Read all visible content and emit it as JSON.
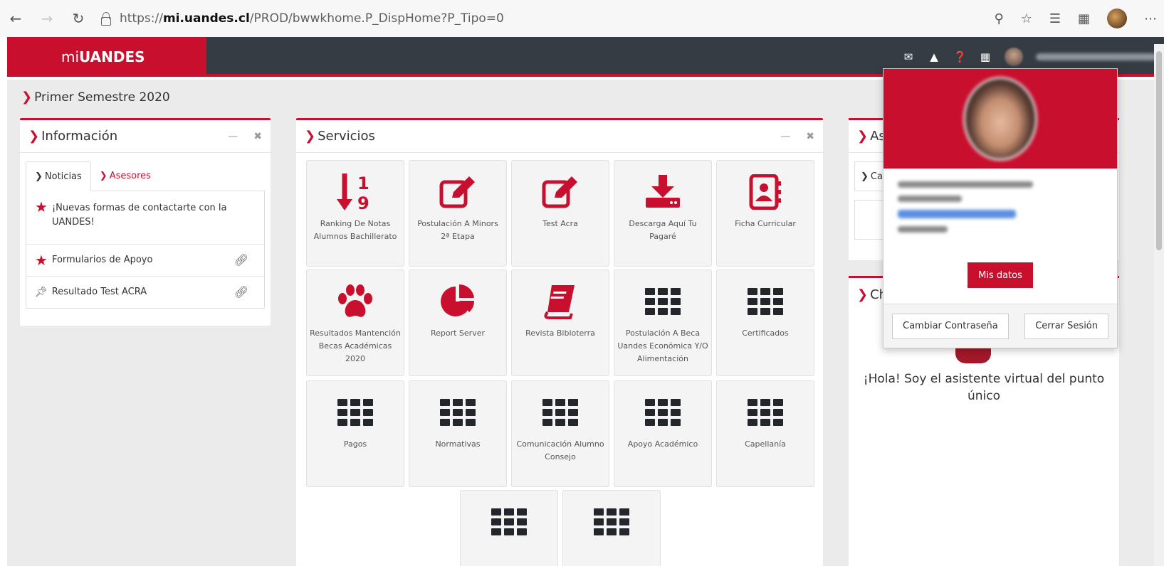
{
  "browser": {
    "url_prefix": "https://",
    "url_host": "mi.uandes.cl",
    "url_path": "/PROD/bwwkhome.P_DispHome?P_Tipo=0"
  },
  "header": {
    "brand_prefix": "mi",
    "brand_bold": "UANDES"
  },
  "semester": "Primer Semestre 2020",
  "info_panel": {
    "title": "Información",
    "tabs": [
      "Noticias",
      "Asesores"
    ],
    "items": [
      {
        "text": "¡Nuevas formas de contactarte con la UANDES!",
        "icon": "star-icon"
      },
      {
        "text": "Formularios de Apoyo",
        "icon": "star-icon"
      },
      {
        "text": "Resultado Test ACRA",
        "icon": "pin-icon"
      }
    ]
  },
  "services_panel": {
    "title": "Servicios",
    "tiles": [
      {
        "label": "Ranking De Notas Alumnos Bachillerato",
        "icon": "sort-numeric-icon"
      },
      {
        "label": "Postulación A Minors 2ª Etapa",
        "icon": "edit-icon"
      },
      {
        "label": "Test Acra",
        "icon": "edit-icon"
      },
      {
        "label": "Descarga Aquí Tu Pagaré",
        "icon": "download-icon"
      },
      {
        "label": "Ficha Curricular",
        "icon": "contact-book-icon"
      },
      {
        "label": "Resultados Mantención Becas Académicas 2020",
        "icon": "paw-icon"
      },
      {
        "label": "Report Server",
        "icon": "pie-chart-icon"
      },
      {
        "label": "Revista Bibloterra",
        "icon": "book-icon"
      },
      {
        "label": "Postulación A Beca Uandes Económica Y/O Alimentación",
        "icon": "grid-icon"
      },
      {
        "label": "Certificados",
        "icon": "grid-icon"
      },
      {
        "label": "Pagos",
        "icon": "grid-icon"
      },
      {
        "label": "Normativas",
        "icon": "grid-icon"
      },
      {
        "label": "Comunicación Alumno Consejo",
        "icon": "grid-icon"
      },
      {
        "label": "Apoyo Académico",
        "icon": "grid-icon"
      },
      {
        "label": "Capellanía",
        "icon": "grid-icon"
      },
      {
        "label": "",
        "icon": "grid-icon"
      },
      {
        "label": "",
        "icon": "grid-icon"
      }
    ]
  },
  "side_panels": {
    "top_title": "As",
    "top_tab": "Ca",
    "bottom_title": "Ch",
    "chat_text": "¡Hola! Soy el asistente virtual del punto único"
  },
  "user_menu": {
    "mis_datos": "Mis datos",
    "change_password": "Cambiar Contraseña",
    "logout": "Cerrar Sesión"
  },
  "colors": {
    "accent": "#c8102e",
    "header": "#363c43"
  }
}
